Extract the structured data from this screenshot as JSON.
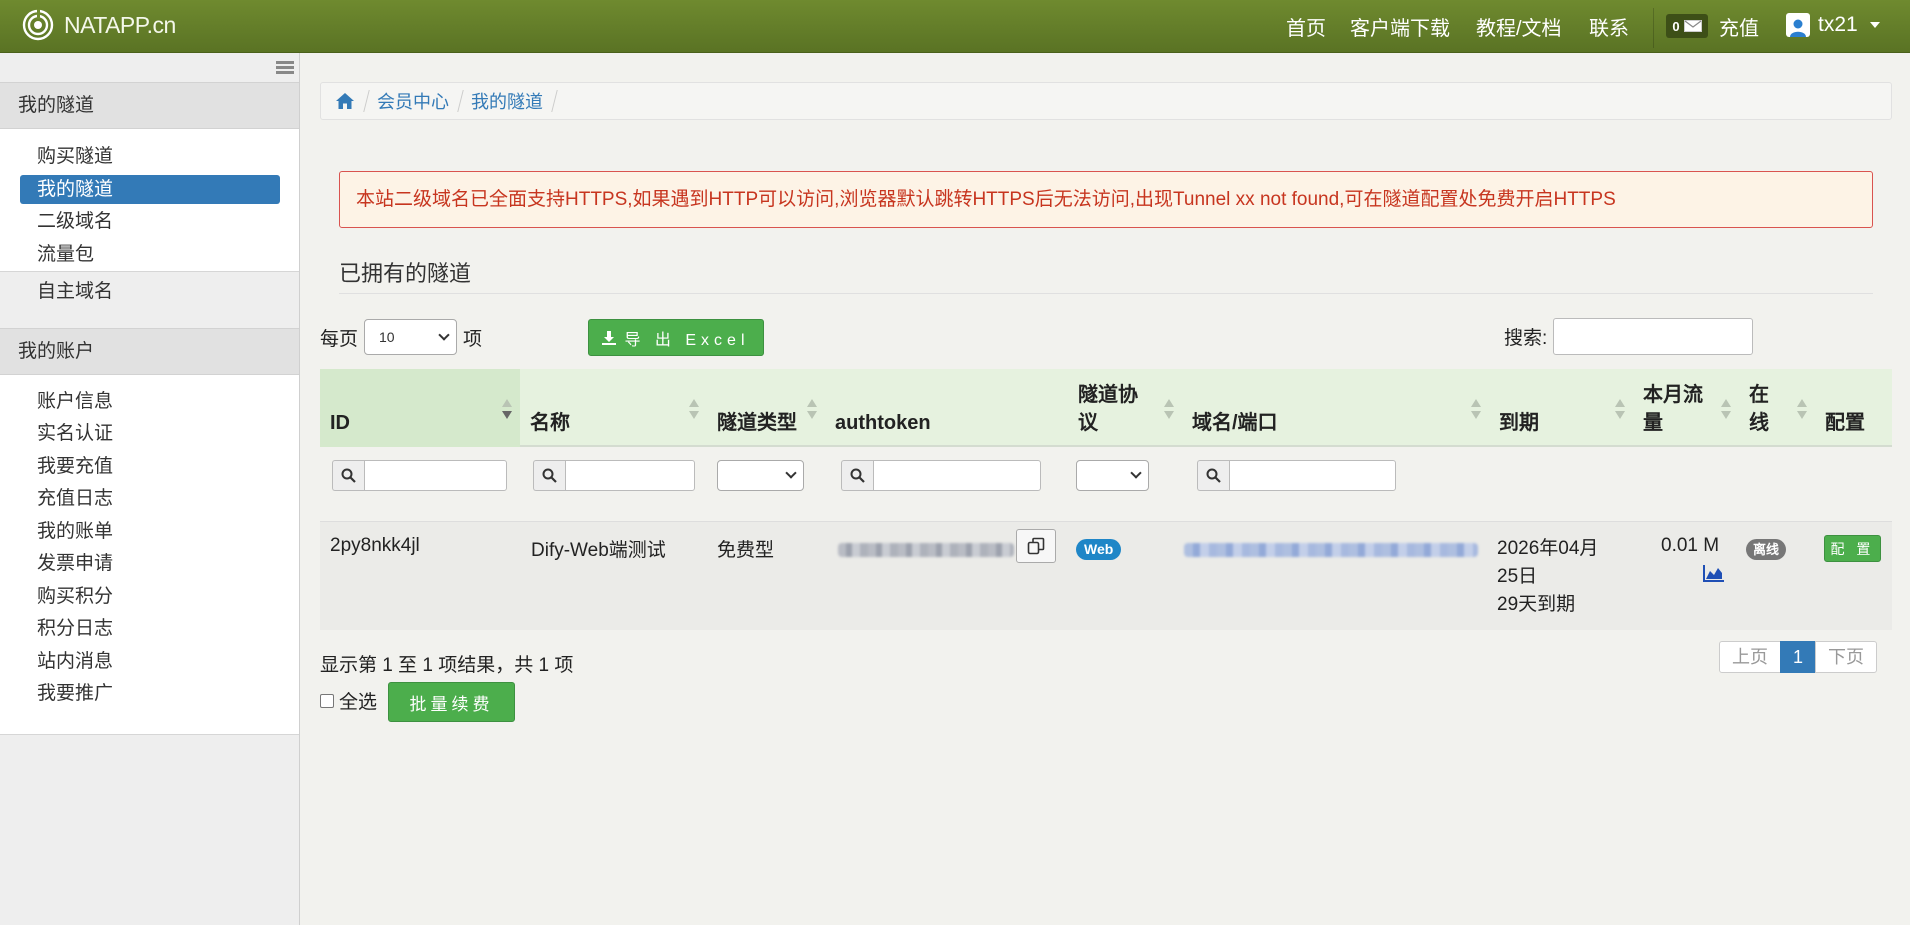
{
  "navbar": {
    "brand": "NATAPP.cn",
    "links": [
      "首页",
      "客户端下载",
      "教程/文档",
      "联系"
    ],
    "message_count": "0",
    "recharge": "充值",
    "username": "tx21"
  },
  "sidebar": {
    "section1": {
      "title": "我的隧道",
      "items": [
        "购买隧道",
        "我的隧道",
        "二级域名",
        "流量包",
        "自主域名"
      ],
      "active": "我的隧道"
    },
    "section2": {
      "title": "我的账户",
      "items": [
        "账户信息",
        "实名认证",
        "我要充值",
        "充值日志",
        "我的账单",
        "发票申请",
        "购买积分",
        "积分日志",
        "站内消息",
        "我要推广"
      ]
    }
  },
  "breadcrumb": [
    "会员中心",
    "我的隧道"
  ],
  "alert": "本站二级域名已全面支持HTTPS,如果遇到HTTP可以访问,浏览器默认跳转HTTPS后无法访问,出现Tunnel xx not found,可在隧道配置处免费开启HTTPS",
  "section_title": "已拥有的隧道",
  "controls": {
    "per_page_prefix": "每页",
    "per_page_value": "10",
    "per_page_suffix": "项",
    "export_label": "导 出 Excel",
    "search_label": "搜索:"
  },
  "table": {
    "columns": [
      "ID",
      "名称",
      "隧道类型",
      "authtoken",
      "隧道协议",
      "域名/端口",
      "到期",
      "本月流量",
      "在线",
      "配置"
    ],
    "rows": [
      {
        "id": "2py8nkk4jl",
        "name": "Dify-Web端测试",
        "type": "免费型",
        "protocol": "Web",
        "expiry_line1": "2026年04月",
        "expiry_line2": "25日",
        "expiry_line3": "29天到期",
        "traffic": "0.01 M",
        "online": "离线",
        "config": "配 置"
      }
    ]
  },
  "footer": {
    "result_info": "显示第 1 至 1 项结果，共 1 项",
    "prev": "上页",
    "page": "1",
    "next": "下页",
    "select_all": "全选",
    "renew": "批量续费"
  },
  "colors": {
    "navbar": "#6f8a2f",
    "primary": "#337ab7",
    "success": "#4cae4c",
    "alert_text": "#c7351f",
    "table_header": "#e6f2df"
  }
}
